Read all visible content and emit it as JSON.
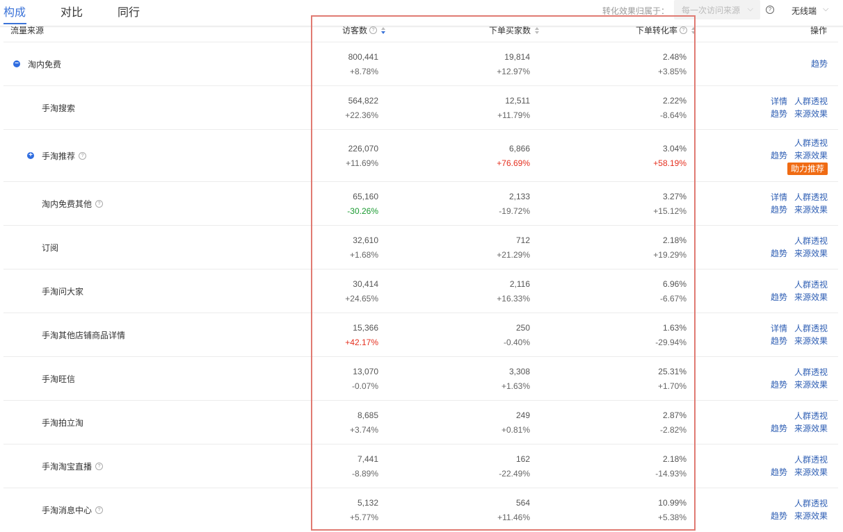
{
  "tabs": [
    "构成",
    "对比",
    "同行"
  ],
  "filter": {
    "attribution_label": "转化效果归属于：",
    "attribution_value": "每一次访问来源",
    "device": "无线端"
  },
  "header": {
    "source": "流量来源",
    "visitors": "访客数",
    "buyers": "下单买家数",
    "conversion": "下单转化率",
    "action": "操作"
  },
  "rows": [
    {
      "name": "淘内免费",
      "visitors": "800,441",
      "visitors_delta": "+8.78%",
      "buyers": "19,814",
      "buyers_delta": "+12.97%",
      "conv": "2.48%",
      "conv_delta": "+3.85%",
      "ops": [
        [
          "趋势"
        ]
      ]
    },
    {
      "name": "手淘搜索",
      "visitors": "564,822",
      "visitors_delta": "+22.36%",
      "buyers": "12,511",
      "buyers_delta": "+11.79%",
      "conv": "2.22%",
      "conv_delta": "-8.64%",
      "ops": [
        [
          "详情",
          "人群透视"
        ],
        [
          "趋势",
          "来源效果"
        ]
      ]
    },
    {
      "name": "手淘推荐",
      "visitors": "226,070",
      "visitors_delta": "+11.69%",
      "buyers": "6,866",
      "buyers_delta": "+76.69%",
      "conv": "3.04%",
      "conv_delta": "+58.19%",
      "ops": [
        [
          "人群透视"
        ],
        [
          "趋势",
          "来源效果"
        ]
      ],
      "badge": "助力推荐"
    },
    {
      "name": "淘内免费其他",
      "visitors": "65,160",
      "visitors_delta": "-30.26%",
      "buyers": "2,133",
      "buyers_delta": "-19.72%",
      "conv": "3.27%",
      "conv_delta": "+15.12%",
      "ops": [
        [
          "详情",
          "人群透视"
        ],
        [
          "趋势",
          "来源效果"
        ]
      ]
    },
    {
      "name": "订阅",
      "visitors": "32,610",
      "visitors_delta": "+1.68%",
      "buyers": "712",
      "buyers_delta": "+21.29%",
      "conv": "2.18%",
      "conv_delta": "+19.29%",
      "ops": [
        [
          "人群透视"
        ],
        [
          "趋势",
          "来源效果"
        ]
      ]
    },
    {
      "name": "手淘问大家",
      "visitors": "30,414",
      "visitors_delta": "+24.65%",
      "buyers": "2,116",
      "buyers_delta": "+16.33%",
      "conv": "6.96%",
      "conv_delta": "-6.67%",
      "ops": [
        [
          "人群透视"
        ],
        [
          "趋势",
          "来源效果"
        ]
      ]
    },
    {
      "name": "手淘其他店铺商品详情",
      "visitors": "15,366",
      "visitors_delta": "+42.17%",
      "buyers": "250",
      "buyers_delta": "-0.40%",
      "conv": "1.63%",
      "conv_delta": "-29.94%",
      "ops": [
        [
          "详情",
          "人群透视"
        ],
        [
          "趋势",
          "来源效果"
        ]
      ]
    },
    {
      "name": "手淘旺信",
      "visitors": "13,070",
      "visitors_delta": "-0.07%",
      "buyers": "3,308",
      "buyers_delta": "+1.63%",
      "conv": "25.31%",
      "conv_delta": "+1.70%",
      "ops": [
        [
          "人群透视"
        ],
        [
          "趋势",
          "来源效果"
        ]
      ]
    },
    {
      "name": "手淘拍立淘",
      "visitors": "8,685",
      "visitors_delta": "+3.74%",
      "buyers": "249",
      "buyers_delta": "+0.81%",
      "conv": "2.87%",
      "conv_delta": "-2.82%",
      "ops": [
        [
          "人群透视"
        ],
        [
          "趋势",
          "来源效果"
        ]
      ]
    },
    {
      "name": "手淘淘宝直播",
      "visitors": "7,441",
      "visitors_delta": "-8.89%",
      "buyers": "162",
      "buyers_delta": "-22.49%",
      "conv": "2.18%",
      "conv_delta": "-14.93%",
      "ops": [
        [
          "人群透视"
        ],
        [
          "趋势",
          "来源效果"
        ]
      ]
    },
    {
      "name": "手淘消息中心",
      "visitors": "5,132",
      "visitors_delta": "+5.77%",
      "buyers": "564",
      "buyers_delta": "+11.46%",
      "conv": "10.99%",
      "conv_delta": "+5.38%",
      "ops": [
        [
          "人群透视"
        ],
        [
          "趋势",
          "来源效果"
        ]
      ]
    }
  ],
  "colors": {
    "accent": "#3b73d8",
    "link": "#2f5fb4",
    "up_highlight": "#e5301f",
    "down_highlight": "#1a9a31",
    "badge": "#f06b13",
    "annotation": "#e07a72"
  }
}
